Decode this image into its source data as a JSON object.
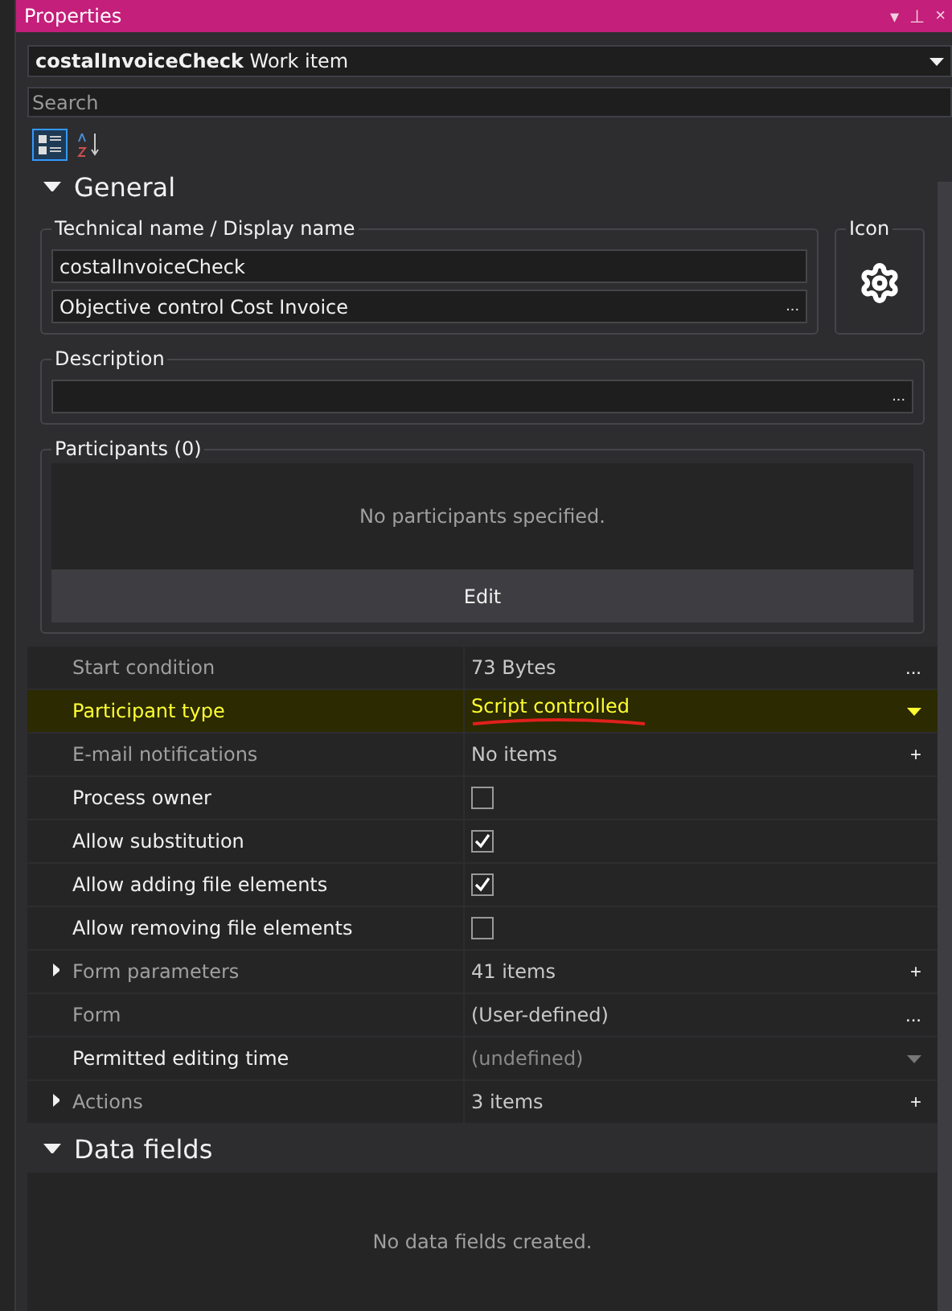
{
  "panel": {
    "title": "Properties",
    "buttons": [
      "▾",
      "⊥",
      "×"
    ]
  },
  "object_selector": {
    "name": "costalInvoiceCheck",
    "type": "Work item"
  },
  "search": {
    "placeholder": "Search"
  },
  "view_toggles": [
    {
      "kind": "categorized",
      "selected": true
    },
    {
      "kind": "alphabetical",
      "selected": false
    }
  ],
  "sections": [
    {
      "title": "General",
      "expanded": true
    },
    {
      "title": "Data fields",
      "expanded": true
    }
  ],
  "naming": {
    "legend": "Technical name / Display name",
    "technical_name": "costalInvoiceCheck",
    "display_name": "Objective control Cost Invoice",
    "ellipsis": "..."
  },
  "icon_box": {
    "legend": "Icon"
  },
  "description": {
    "legend": "Description",
    "ellipsis": "..."
  },
  "participants": {
    "legend": "Participants (0)",
    "empty_text": "No participants specified.",
    "button": "Edit"
  },
  "properties": [
    {
      "label": "Start condition",
      "kind": "text",
      "value": "73 Bytes",
      "action": "...",
      "dimmed": true,
      "highlighted": false
    },
    {
      "label": "Participant type",
      "kind": "dropdown",
      "value": "Script controlled",
      "dimmed": false,
      "highlighted": true
    },
    {
      "label": "E-mail notifications",
      "kind": "text",
      "value": "No items",
      "action": "+",
      "dimmed": true,
      "highlighted": false
    },
    {
      "label": "Process owner",
      "kind": "checkbox",
      "checked": false,
      "dimmed": false,
      "highlighted": false
    },
    {
      "label": "Allow substitution",
      "kind": "checkbox",
      "checked": true,
      "dimmed": false,
      "highlighted": false
    },
    {
      "label": "Allow adding file elements",
      "kind": "checkbox",
      "checked": true,
      "dimmed": false,
      "highlighted": false
    },
    {
      "label": "Allow removing file elements",
      "kind": "checkbox",
      "checked": false,
      "dimmed": false,
      "highlighted": false
    },
    {
      "label": "Form parameters",
      "kind": "text",
      "value": "41 items",
      "action": "+",
      "expanded": false,
      "dimmed": true,
      "highlighted": false
    },
    {
      "label": "Form",
      "kind": "text",
      "value": "(User-defined)",
      "action": "...",
      "dimmed": true,
      "highlighted": false
    },
    {
      "label": "Permitted editing time",
      "kind": "dropdown",
      "value": "(undefined)",
      "value_dimmed": true,
      "dimmed": false,
      "highlighted": false
    },
    {
      "label": "Actions",
      "kind": "text",
      "value": "3 items",
      "action": "+",
      "expanded": false,
      "dimmed": true,
      "highlighted": false
    }
  ],
  "data_fields": {
    "empty_text": "No data fields created."
  }
}
